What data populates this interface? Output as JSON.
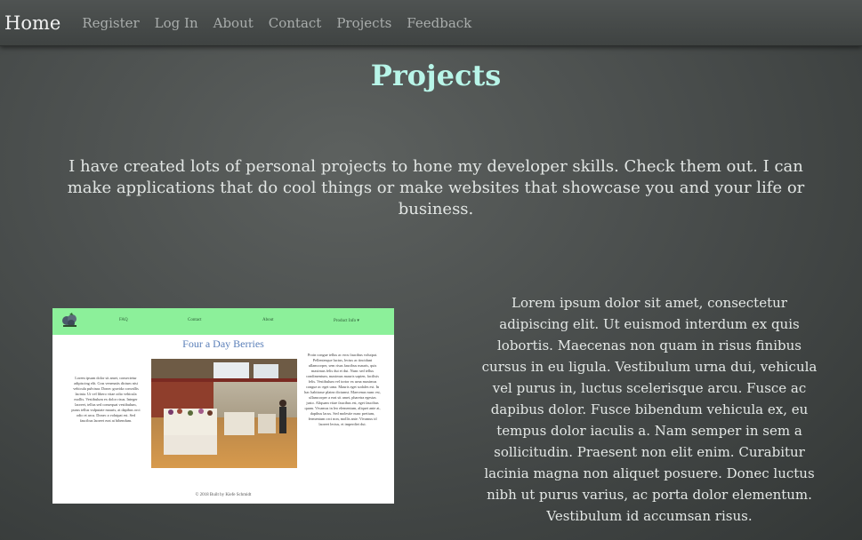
{
  "nav": {
    "brand": "Home",
    "links": [
      "Register",
      "Log In",
      "About",
      "Contact",
      "Projects",
      "Feedback"
    ]
  },
  "page": {
    "title": "Projects",
    "intro": "I have created lots of personal projects to hone my developer skills. Check them out. I can make applications that do cool things or make websites that showcase you and your life or business."
  },
  "project": {
    "screenshot": {
      "nav": [
        "FAQ",
        "Contact",
        "About",
        "Product Info ▾"
      ],
      "title": "Four a Day Berries",
      "left_text": "Lorem ipsum dolor sit amet, consectetur adipiscing elit. Cras venenatis dictum nisi vehicula pulvinar. Donec gravida convallis lacinia. Ut vel libero vitae odio vehicula mollis. Vestibulum ex dolor risus. Integer laoreet, tellus sed consequat vestibulum, purus tellus vulputate mauris, at dapibus orci odio et arcu. Donec a volutpat est. Sed faucibus laoreet erat at bibendum.",
      "right_text": "Proin congue tellus ac eros faucibus volutpat. Pellentesque luctus, lectus ac tincidunt ullamcorper, sem risus faucibus mauris, quis maximus felis dui et dui. Nunc sed tellus condimentum, maximus mauris sapien, facilisis felis. Vestibulum vel tortor ex urna maximus congue ac eget urna. Mauris eget sodales est. In hac habitasse platea dictumst. Maecenas nunc est, ullamcorper a erat sit amet, pharetra egestas justo. Aliquam vitae faucibus est, eget faucibus quam. Vivamus in leo elementum, aliquet ante at, dapibus lacus. Sed molestie nunc pretium, fermentum orci non, mollis ante. Vivamus id laoreet lectus, et imperdiet dui.",
      "footer": "© 2018 Built by Kiefe Schmidt"
    },
    "description": "Lorem ipsum dolor sit amet, consectetur adipiscing elit. Ut euismod interdum ex quis lobortis. Maecenas non quam in risus finibus cursus in eu ligula. Vestibulum urna dui, vehicula vel purus in, luctus scelerisque arcu. Fusce ac dapibus dolor. Fusce bibendum vehicula ex, eu tempus dolor iaculis a. Nam semper in sem a sollicitudin. Praesent non elit enim. Curabitur lacinia magna non aliquet posuere. Donec luctus nibh ut purus varius, ac porta dolor elementum. Vestibulum id accumsan risus."
  },
  "colors": {
    "title": "#b8f5e8",
    "preview_nav": "#8cf09a",
    "preview_title": "#5a7fb8"
  }
}
